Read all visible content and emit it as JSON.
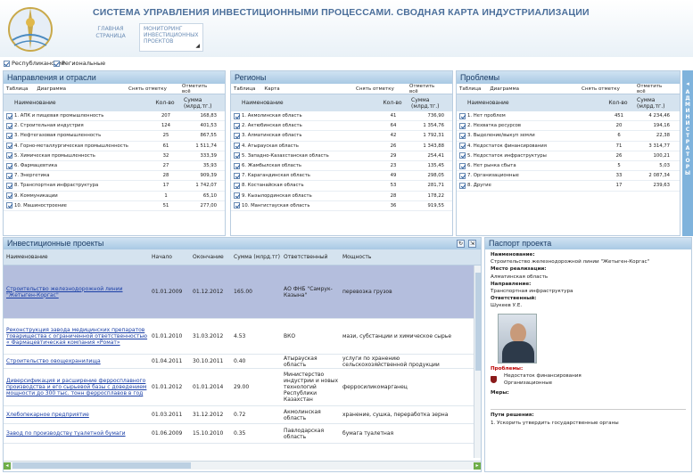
{
  "header": {
    "title": "СИСТЕМА УПРАВЛЕНИЯ ИНВЕСТИЦИОННЫМИ ПРОЦЕССАМИ. СВОДНАЯ КАРТА ИНДУСТРИАЛИЗАЦИИ",
    "nav_home": "ГЛАВНАЯ СТРАНИЦА",
    "nav_monitoring": "МОНИТОРИНГ ИНВЕСТИЦИОННЫХ ПРОЕКТОВ"
  },
  "filters": {
    "republican": "Республиканские",
    "regional": "Региональные"
  },
  "common": {
    "table": "Таблица",
    "diagram": "Диаграмма",
    "map": "Карта",
    "clear": "Снять отметку",
    "select_all": "Отметить всё",
    "col_name": "Наименование",
    "col_count": "Кол-во",
    "col_sum": "Сумма (млрд.тг.)"
  },
  "directions": {
    "title": "Направления и отрасли",
    "rows": [
      {
        "name": "1. АПК и пищевая промышленность",
        "count": "207",
        "sum": "168,83"
      },
      {
        "name": "2. Строительная индустрия",
        "count": "124",
        "sum": "401,53"
      },
      {
        "name": "3. Нефтегазовая промышленность",
        "count": "25",
        "sum": "867,55"
      },
      {
        "name": "4. Горно-металлургическая промышленность",
        "count": "61",
        "sum": "1 511,74"
      },
      {
        "name": "5. Химическая промышленность",
        "count": "32",
        "sum": "333,39"
      },
      {
        "name": "6. Фармацевтика",
        "count": "27",
        "sum": "35,93"
      },
      {
        "name": "7. Энергетика",
        "count": "28",
        "sum": "909,39"
      },
      {
        "name": "8. Транспортная инфраструктура",
        "count": "17",
        "sum": "1 742,07"
      },
      {
        "name": "9. Коммуникации",
        "count": "1",
        "sum": "65,10"
      },
      {
        "name": "10. Машиностроение",
        "count": "51",
        "sum": "277,00"
      }
    ]
  },
  "regions": {
    "title": "Регионы",
    "rows": [
      {
        "name": "1. Акмолинская область",
        "count": "41",
        "sum": "736,90"
      },
      {
        "name": "2. Актюбинская область",
        "count": "64",
        "sum": "1 354,76"
      },
      {
        "name": "3. Алматинская область",
        "count": "42",
        "sum": "1 792,31"
      },
      {
        "name": "4. Атырауская область",
        "count": "26",
        "sum": "1 343,88"
      },
      {
        "name": "5. Западно-Казахстанская область",
        "count": "29",
        "sum": "254,41"
      },
      {
        "name": "6. Жамбылская область",
        "count": "23",
        "sum": "135,45"
      },
      {
        "name": "7. Карагандинская область",
        "count": "49",
        "sum": "298,05"
      },
      {
        "name": "8. Костанайская область",
        "count": "53",
        "sum": "281,71"
      },
      {
        "name": "9. Кызылординская область",
        "count": "28",
        "sum": "178,22"
      },
      {
        "name": "10. Мангистауская область",
        "count": "36",
        "sum": "919,55"
      }
    ]
  },
  "problems": {
    "title": "Проблемы",
    "rows": [
      {
        "name": "1. Нет проблем",
        "count": "451",
        "sum": "4 234,46"
      },
      {
        "name": "2. Нехватка ресурсов",
        "count": "20",
        "sum": "194,16"
      },
      {
        "name": "3. Выделение/выкуп земли",
        "count": "6",
        "sum": "22,38"
      },
      {
        "name": "4. Недостаток финансирования",
        "count": "71",
        "sum": "3 314,77"
      },
      {
        "name": "5. Недостаток инфраструктуры",
        "count": "26",
        "sum": "100,21"
      },
      {
        "name": "6. Нет рынка сбыта",
        "count": "5",
        "sum": "5,03"
      },
      {
        "name": "7. Организационные",
        "count": "33",
        "sum": "2 087,34"
      },
      {
        "name": "8. Другие",
        "count": "17",
        "sum": "239,63"
      }
    ]
  },
  "side_tab": "АДМИНИСТРАТОРЫ",
  "projects": {
    "title": "Инвестиционные проекты",
    "columns": [
      "Наименование",
      "Начало",
      "Окончание",
      "Сумма (млрд.тг)",
      "Ответственный",
      "Мощность"
    ],
    "rows": [
      {
        "name": "Строительство железнодорожной линии \"Жетыген-Коргас\"",
        "start": "01.01.2009",
        "end": "01.12.2012",
        "sum": "165.00",
        "resp": "АО ФНБ \"Самрук-Казына\"",
        "power": "перевозка грузов"
      },
      {
        "name": "Реконструкция завода медицинских препаратов товарищества с ограниченной ответственностью « Фармацевтическая компания «Ромат»",
        "start": "01.01.2010",
        "end": "31.03.2012",
        "sum": "4.53",
        "resp": "ВКО",
        "power": "мази, субстанции и химическое сырье"
      },
      {
        "name": "Строительство овощехранилища",
        "start": "01.04.2011",
        "end": "30.10.2011",
        "sum": "0.40",
        "resp": "Атырауская область",
        "power": "услуги по хранению сельскохозяйственной продукции"
      },
      {
        "name": "Диверсификация и расширение ферросплавного производства и его сырьевой базы с доведением мощности до 300 тыс. тонн ферросплавов в год",
        "start": "01.01.2012",
        "end": "01.01.2014",
        "sum": "29.00",
        "resp": "Министерство индустрии и новых технологий Республики Казахстан",
        "power": "ферросиликомарганец"
      },
      {
        "name": "Хлебопекарное предприятие",
        "start": "01.03.2011",
        "end": "31.12.2012",
        "sum": "0.72",
        "resp": "Акмолинская область",
        "power": "хранение, сушка, переработка зерна"
      },
      {
        "name": "Завод по производству туалетной бумаги",
        "start": "01.06.2009",
        "end": "15.10.2010",
        "sum": "0.35",
        "resp": "Павлодарская область",
        "power": "бумага туалетная"
      }
    ]
  },
  "passport": {
    "title": "Паспорт проекта",
    "name_label": "Наименование:",
    "name_value": "Строительство железнодорожной линии \"Жетыген-Коргас\"",
    "place_label": "Место реализации:",
    "place_value": "Алматинская область",
    "direction_label": "Направление:",
    "direction_value": "Транспортная инфраструктура",
    "resp_label": "Ответственный:",
    "resp_value": "Шукеев У.Е.",
    "problems_label": "Проблемы:",
    "problem1": "Недостаток финансирования",
    "problem2": "Организационные",
    "measures_label": "Меры:",
    "solutions_label": "Пути решения:",
    "solution1": "1. Ускорить утвердить государственные органы"
  }
}
